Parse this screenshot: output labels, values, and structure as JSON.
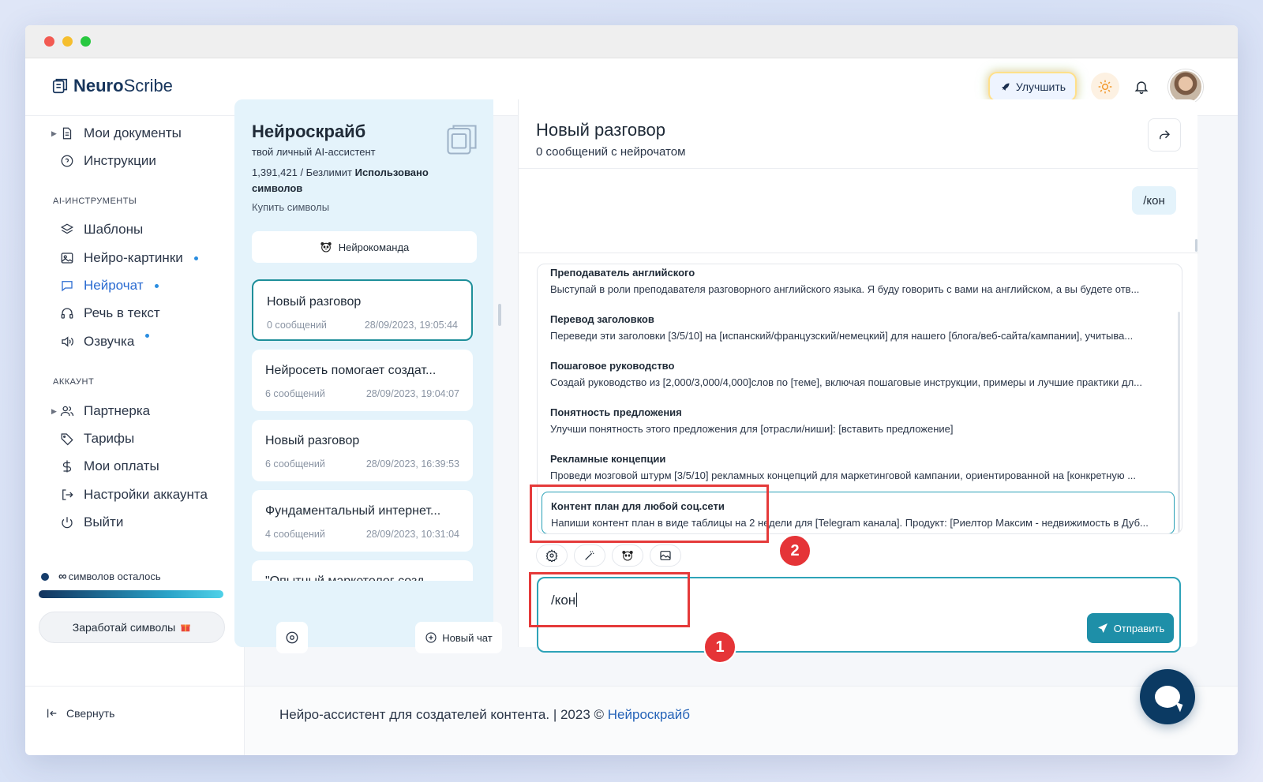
{
  "app": {
    "logo_bold": "Neuro",
    "logo_regular": "Scribe"
  },
  "header": {
    "upgrade_label": "Улучшить"
  },
  "sidebar": {
    "items_top": [
      {
        "label": "Мои документы",
        "icon": "document-icon"
      },
      {
        "label": "Инструкции",
        "icon": "help-circle-icon"
      }
    ],
    "ai_section": "AI-ИНСТРУМЕНТЫ",
    "ai_items": [
      {
        "label": "Шаблоны",
        "icon": "layers-icon"
      },
      {
        "label": "Нейро-картинки",
        "icon": "image-icon"
      },
      {
        "label": "Нейрочат",
        "icon": "chat-icon"
      },
      {
        "label": "Речь в текст",
        "icon": "headphones-icon"
      },
      {
        "label": "Озвучка",
        "icon": "speaker-icon"
      }
    ],
    "account_section": "АККАУНТ",
    "account_items": [
      {
        "label": "Партнерка",
        "icon": "users-icon"
      },
      {
        "label": "Тарифы",
        "icon": "tag-icon"
      },
      {
        "label": "Мои оплаты",
        "icon": "dollar-icon"
      },
      {
        "label": "Настройки аккаунта",
        "icon": "login-icon"
      },
      {
        "label": "Выйти",
        "icon": "power-icon"
      }
    ],
    "symbols_infinity": "∞",
    "symbols_left": "символов осталось",
    "symbols_progress": 1.0,
    "earn_label": "Заработай символы",
    "collapse_label": "Свернуть"
  },
  "assistant": {
    "title": "Нейроскрайб",
    "subtitle": "твой личный AI-ассистент",
    "count": "1,391,421",
    "count_rest": " / Безлимит ",
    "count_used": "Использовано символов",
    "buy": "Купить символы",
    "team_button": "Нейрокоманда",
    "new_chat": "Новый чат"
  },
  "chats": [
    {
      "title": "Новый разговор",
      "messages": "0 сообщений",
      "date": "28/09/2023, 19:05:44"
    },
    {
      "title": "Нейросеть помогает создат...",
      "messages": "6 сообщений",
      "date": "28/09/2023, 19:04:07"
    },
    {
      "title": "Новый разговор",
      "messages": "6 сообщений",
      "date": "28/09/2023, 16:39:53"
    },
    {
      "title": "Фундаментальный интернет...",
      "messages": "4 сообщений",
      "date": "28/09/2023, 10:31:04"
    },
    {
      "title": "\"Опытный маркетолог созд...",
      "messages": "",
      "date": ""
    }
  ],
  "conversation": {
    "title": "Новый разговор",
    "subtitle": "0 сообщений с нейрочатом",
    "user_message": "/кон"
  },
  "suggestions": [
    {
      "title": "Преподаватель английского",
      "text": "Выступай в роли преподавателя разговорного английского языка. Я буду говорить с вами на английском, а вы будете отв..."
    },
    {
      "title": "Перевод заголовков",
      "text": "Переведи эти заголовки [3/5/10] на [испанский/французский/немецкий] для нашего [блога/веб-сайта/кампании], учитыва..."
    },
    {
      "title": "Пошаговое руководство",
      "text": "Создай руководство из [2,000/3,000/4,000]слов по [теме], включая пошаговые инструкции, примеры и лучшие практики дл..."
    },
    {
      "title": "Понятность предложения",
      "text": "Улучши понятность этого предложения для [отрасли/ниши]: [вставить предложение]"
    },
    {
      "title": "Рекламные концепции",
      "text": "Проведи мозговой штурм [3/5/10] рекламных концепций для маркетинговой кампании, ориентированной на [конкретную ..."
    },
    {
      "title": "Контент план для любой соц.сети",
      "text": "Напиши контент план в виде таблицы на 2 недели для [Telegram канала]. Продукт: [Риелтор Максим - недвижимость в Дуб..."
    }
  ],
  "composer": {
    "value": "/кон",
    "send_label": "Отправить"
  },
  "annotations": {
    "badge_1": "1",
    "badge_2": "2"
  },
  "footer": {
    "text": "Нейро-ассистент для создателей контента.  | 2023 © ",
    "link": "Нейроскрайб"
  }
}
